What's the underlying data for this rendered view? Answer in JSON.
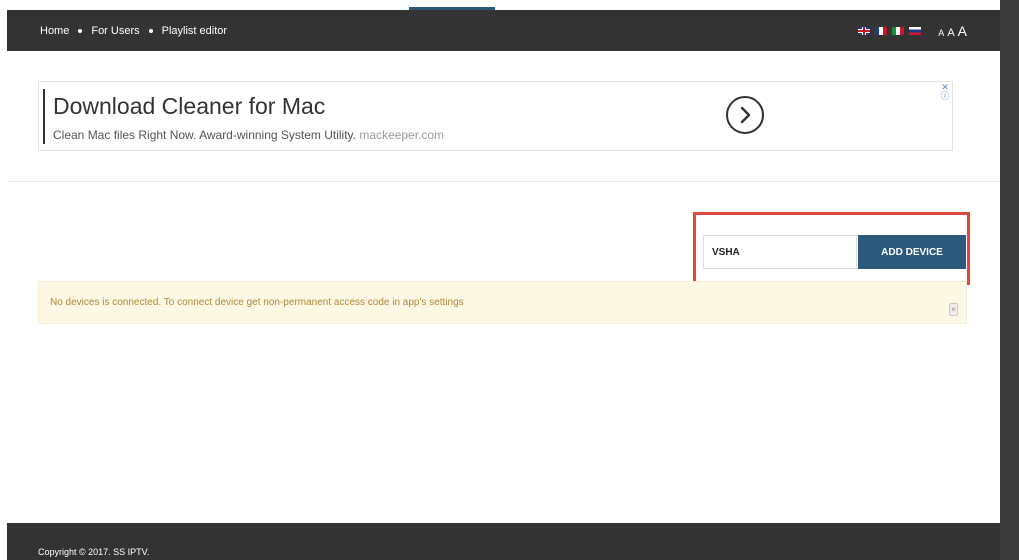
{
  "nav": {
    "breadcrumb": [
      {
        "label": "Home"
      },
      {
        "label": "For Users"
      },
      {
        "label": "Playlist editor"
      }
    ],
    "languages": [
      {
        "icon": "flag-uk-icon",
        "color": "#1f3c88"
      },
      {
        "icon": "flag-fr-icon",
        "color": "#1f3c88"
      },
      {
        "icon": "flag-it-icon",
        "color": "#1f8c3c"
      },
      {
        "icon": "flag-ru-icon",
        "color": "#cf142b"
      }
    ],
    "font_sizes": [
      "A",
      "A",
      "A"
    ]
  },
  "ad": {
    "title": "Download Cleaner for Mac",
    "subtitle": "Clean Mac files Right Now. Award-winning System Utility.",
    "domain": "mackeeper.com",
    "arrow_icon": "chevron-right-icon",
    "close_icon": "ad-close-icon"
  },
  "device_form": {
    "code_value": "VSHA",
    "add_button_label": "ADD DEVICE",
    "highlight_color": "#e0463b",
    "button_color": "#2b5a7d"
  },
  "alert": {
    "message": "No devices is connected. To connect device get non-permanent access code in app's settings",
    "close_icon": "close-icon",
    "background_color": "#fcf8e3"
  },
  "footer": {
    "copyright": "Copyright © 2017. SS IPTV."
  }
}
